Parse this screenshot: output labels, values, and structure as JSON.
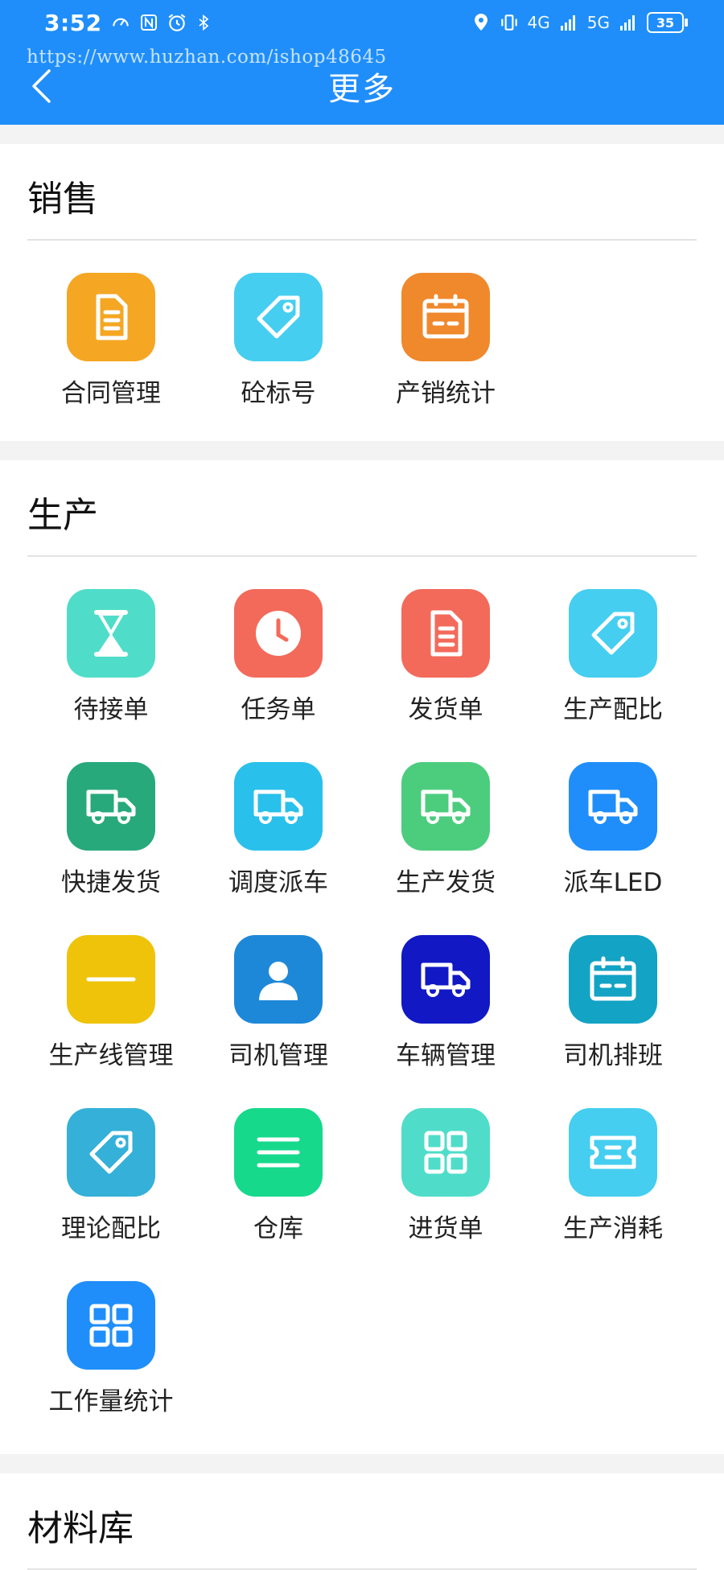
{
  "status_bar": {
    "time": "3:52",
    "battery": "35",
    "net1": "4G",
    "net2": "5G"
  },
  "watermark": "https://www.huzhan.com/ishop48645",
  "header": {
    "title": "更多"
  },
  "sections": [
    {
      "title": "销售",
      "items": [
        {
          "label": "合同管理",
          "icon": "document-icon",
          "color": "#f5a623"
        },
        {
          "label": "砼标号",
          "icon": "tag-icon",
          "color": "#45cef0"
        },
        {
          "label": "产销统计",
          "icon": "calendar-icon",
          "color": "#f0882c"
        }
      ]
    },
    {
      "title": "生产",
      "items": [
        {
          "label": "待接单",
          "icon": "hourglass-icon",
          "color": "#4fddc9"
        },
        {
          "label": "任务单",
          "icon": "clock-icon",
          "color": "#f36a5a"
        },
        {
          "label": "发货单",
          "icon": "document-icon",
          "color": "#f36a5a"
        },
        {
          "label": "生产配比",
          "icon": "tag-icon",
          "color": "#45cef0"
        },
        {
          "label": "快捷发货",
          "icon": "truck-icon",
          "color": "#27a97c"
        },
        {
          "label": "调度派车",
          "icon": "truck-icon",
          "color": "#29c0eb"
        },
        {
          "label": "生产发货",
          "icon": "truck-icon",
          "color": "#4ccd7e"
        },
        {
          "label": "派车LED",
          "icon": "truck-icon",
          "color": "#1f8efa"
        },
        {
          "label": "生产线管理",
          "icon": "line-icon",
          "color": "#eec30a"
        },
        {
          "label": "司机管理",
          "icon": "person-icon",
          "color": "#1e88d8"
        },
        {
          "label": "车辆管理",
          "icon": "truck-icon",
          "color": "#1118c4"
        },
        {
          "label": "司机排班",
          "icon": "calendar-icon",
          "color": "#13a3c4"
        },
        {
          "label": "理论配比",
          "icon": "tag-icon",
          "color": "#35b0d8"
        },
        {
          "label": "仓库",
          "icon": "menu-icon",
          "color": "#16d98c"
        },
        {
          "label": "进货单",
          "icon": "grid-icon",
          "color": "#4fddc9"
        },
        {
          "label": "生产消耗",
          "icon": "ticket-icon",
          "color": "#45cef0"
        },
        {
          "label": "工作量统计",
          "icon": "grid-icon",
          "color": "#1f8efa"
        }
      ]
    },
    {
      "title": "材料库",
      "items": []
    }
  ]
}
